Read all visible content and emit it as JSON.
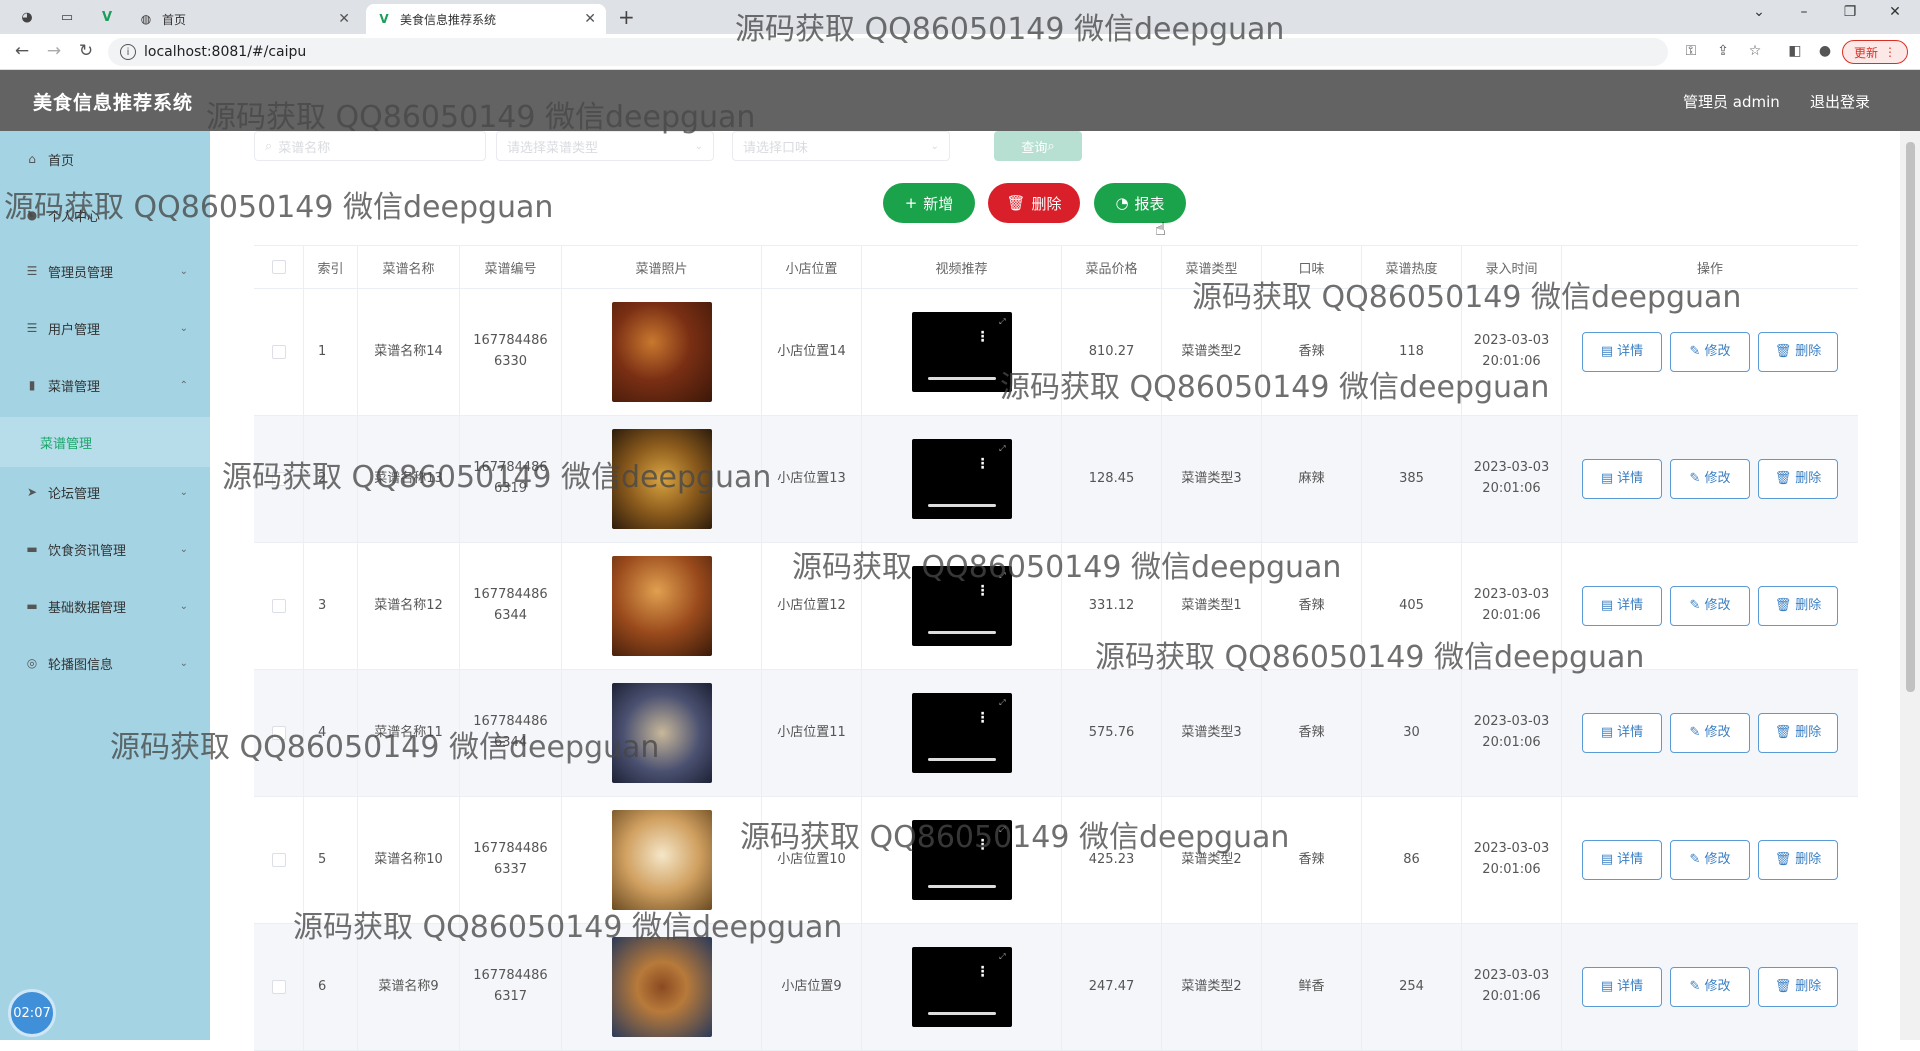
{
  "browser": {
    "tabs": [
      {
        "title": "首页",
        "active": false
      },
      {
        "title": "美食信息推荐系统",
        "active": true
      }
    ],
    "url": "localhost:8081/#/caipu",
    "update_label": "更新"
  },
  "header": {
    "title": "美食信息推荐系统",
    "admin": "管理员 admin",
    "logout": "退出登录"
  },
  "sidebar": {
    "items": [
      {
        "label": "首页",
        "icon": "home-icon"
      },
      {
        "label": "个人中心",
        "icon": "user-icon"
      },
      {
        "label": "管理员管理",
        "icon": "list-icon"
      },
      {
        "label": "用户管理",
        "icon": "list-icon"
      },
      {
        "label": "菜谱管理",
        "icon": "chart-icon"
      },
      {
        "label": "论坛管理",
        "icon": "send-icon"
      },
      {
        "label": "饮食资讯管理",
        "icon": "briefcase-icon"
      },
      {
        "label": "基础数据管理",
        "icon": "monitor-icon"
      },
      {
        "label": "轮播图信息",
        "icon": "compass-icon"
      }
    ],
    "active_sub": "菜谱管理",
    "clock": "02:07"
  },
  "search": {
    "name_placeholder": "菜谱名称",
    "type_placeholder": "请选择菜谱类型",
    "taste_placeholder": "请选择口味",
    "query_label": "查询"
  },
  "actions": {
    "add": "新增",
    "delete": "删除",
    "report": "报表"
  },
  "table": {
    "headers": [
      "索引",
      "菜谱名称",
      "菜谱编号",
      "菜谱照片",
      "小店位置",
      "视频推荐",
      "菜品价格",
      "菜谱类型",
      "口味",
      "菜谱热度",
      "录入时间",
      "操作"
    ],
    "op_detail": "详情",
    "op_edit": "修改",
    "op_delete": "删除",
    "rows": [
      {
        "idx": "1",
        "name": "菜谱名称14",
        "code1": "167784486",
        "code2": "6330",
        "shop": "小店位置14",
        "price": "810.27",
        "type": "菜谱类型2",
        "taste": "香辣",
        "heat": "118",
        "date": "2023-03-03",
        "time": "20:01:06"
      },
      {
        "idx": "2",
        "name": "菜谱名称13",
        "code1": "167784486",
        "code2": "6319",
        "shop": "小店位置13",
        "price": "128.45",
        "type": "菜谱类型3",
        "taste": "麻辣",
        "heat": "385",
        "date": "2023-03-03",
        "time": "20:01:06"
      },
      {
        "idx": "3",
        "name": "菜谱名称12",
        "code1": "167784486",
        "code2": "6344",
        "shop": "小店位置12",
        "price": "331.12",
        "type": "菜谱类型1",
        "taste": "香辣",
        "heat": "405",
        "date": "2023-03-03",
        "time": "20:01:06"
      },
      {
        "idx": "4",
        "name": "菜谱名称11",
        "code1": "167784486",
        "code2": "6344",
        "shop": "小店位置11",
        "price": "575.76",
        "type": "菜谱类型3",
        "taste": "香辣",
        "heat": "30",
        "date": "2023-03-03",
        "time": "20:01:06"
      },
      {
        "idx": "5",
        "name": "菜谱名称10",
        "code1": "167784486",
        "code2": "6337",
        "shop": "小店位置10",
        "price": "425.23",
        "type": "菜谱类型2",
        "taste": "香辣",
        "heat": "86",
        "date": "2023-03-03",
        "time": "20:01:06"
      },
      {
        "idx": "6",
        "name": "菜谱名称9",
        "code1": "167784486",
        "code2": "6317",
        "shop": "小店位置9",
        "price": "247.47",
        "type": "菜谱类型2",
        "taste": "鲜香",
        "heat": "254",
        "date": "2023-03-03",
        "time": "20:01:06"
      }
    ]
  },
  "watermark": "源码获取 QQ86050149 微信deepguan",
  "colors": {
    "header_bg": "#636363",
    "sidebar_bg": "#a4d4e4",
    "primary_green": "#1aa34a",
    "danger_red": "#d9202a",
    "op_blue": "#3a7fc4"
  }
}
